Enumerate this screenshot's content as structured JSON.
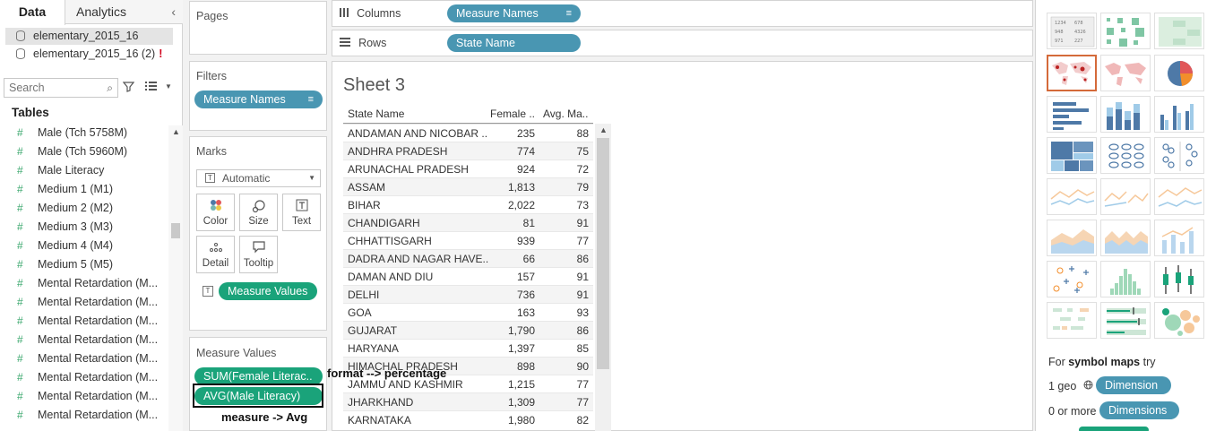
{
  "data_pane": {
    "tabs": [
      "Data",
      "Analytics"
    ],
    "datasources": [
      {
        "name": "elementary_2015_16",
        "warning": ""
      },
      {
        "name": "elementary_2015_16 (2)",
        "warning": "!"
      }
    ],
    "search_placeholder": "Search",
    "tables_header": "Tables",
    "fields": [
      "Male (Tch 5758M)",
      "Male (Tch 5960M)",
      "Male Literacy",
      "Medium 1 (M1)",
      "Medium 2 (M2)",
      "Medium 3 (M3)",
      "Medium 4 (M4)",
      "Medium 5 (M5)",
      "Mental Retardation (M...",
      "Mental Retardation (M...",
      "Mental Retardation (M...",
      "Mental Retardation (M...",
      "Mental Retardation (M...",
      "Mental Retardation (M...",
      "Mental Retardation (M...",
      "Mental Retardation (M..."
    ]
  },
  "cards": {
    "pages": "Pages",
    "filters": {
      "title": "Filters",
      "pill": "Measure Names"
    },
    "marks": {
      "title": "Marks",
      "type": "Automatic",
      "buttons": [
        "Color",
        "Size",
        "Text",
        "Detail",
        "Tooltip"
      ],
      "pill": "Measure Values"
    },
    "measure_values": {
      "title": "Measure Values",
      "pills": [
        "SUM(Female Literac..",
        "AVG(Male Literacy)"
      ]
    }
  },
  "shelves": {
    "columns_label": "Columns",
    "columns_pill": "Measure Names",
    "rows_label": "Rows",
    "rows_pill": "State Name"
  },
  "sheet": {
    "title": "Sheet 3",
    "headers": [
      "State Name",
      "Female ..",
      "Avg. Ma.."
    ],
    "rows": [
      [
        "ANDAMAN AND NICOBAR ..",
        "235",
        "88"
      ],
      [
        "ANDHRA PRADESH",
        "774",
        "75"
      ],
      [
        "ARUNACHAL PRADESH",
        "924",
        "72"
      ],
      [
        "ASSAM",
        "1,813",
        "79"
      ],
      [
        "BIHAR",
        "2,022",
        "73"
      ],
      [
        "CHANDIGARH",
        "81",
        "91"
      ],
      [
        "CHHATTISGARH",
        "939",
        "77"
      ],
      [
        "DADRA AND NAGAR HAVE..",
        "66",
        "86"
      ],
      [
        "DAMAN AND DIU",
        "157",
        "91"
      ],
      [
        "DELHI",
        "736",
        "91"
      ],
      [
        "GOA",
        "163",
        "93"
      ],
      [
        "GUJARAT",
        "1,790",
        "86"
      ],
      [
        "HARYANA",
        "1,397",
        "85"
      ],
      [
        "HIMACHAL PRADESH",
        "898",
        "90"
      ],
      [
        "JAMMU AND KASHMIR",
        "1,215",
        "77"
      ],
      [
        "JHARKHAND",
        "1,309",
        "77"
      ],
      [
        "KARNATAKA",
        "1,980",
        "82"
      ]
    ]
  },
  "annotations": {
    "format": "format --> percentage",
    "measure": "measure -> Avg"
  },
  "show_me": {
    "hint_prefix": "For",
    "hint_bold": "symbol maps",
    "hint_suffix": "try",
    "req1_count": "1 geo",
    "req1_pill": "Dimension",
    "req2_count": "0 or more",
    "req2_pill": "Dimensions"
  },
  "colors": {
    "dimension_pill": "#4996b2",
    "measure_pill": "#1aa37a",
    "selected_outline": "#d46a3a"
  }
}
